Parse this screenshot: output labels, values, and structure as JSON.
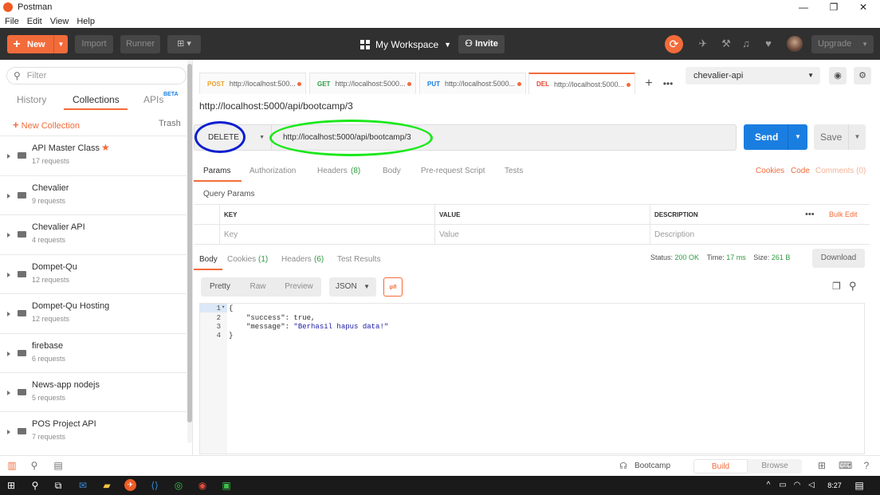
{
  "window": {
    "title": "Postman",
    "controls": [
      "—",
      "❐",
      "✕"
    ]
  },
  "menu": [
    "File",
    "Edit",
    "View",
    "Help"
  ],
  "header": {
    "new_label": "New",
    "import_label": "Import",
    "runner_label": "Runner",
    "workspace_label": "My Workspace",
    "invite_label": "Invite",
    "upgrade_label": "Upgrade"
  },
  "sidebar": {
    "filter_placeholder": "Filter",
    "tabs": [
      "History",
      "Collections",
      "APIs"
    ],
    "beta_badge": "BETA",
    "active_tab": "Collections",
    "new_collection_label": "New Collection",
    "trash_label": "Trash",
    "collections": [
      {
        "name": "API Master Class",
        "count": "17 requests",
        "starred": true
      },
      {
        "name": "Chevalier",
        "count": "9 requests"
      },
      {
        "name": "Chevalier API",
        "count": "4 requests"
      },
      {
        "name": "Dompet-Qu",
        "count": "12 requests"
      },
      {
        "name": "Dompet-Qu Hosting",
        "count": "12 requests"
      },
      {
        "name": "firebase",
        "count": "6 requests"
      },
      {
        "name": "News-app nodejs",
        "count": "5 requests"
      },
      {
        "name": "POS Project API",
        "count": "7 requests"
      }
    ]
  },
  "request_tabs": [
    {
      "method": "POST",
      "url": "http://localhost:500...",
      "color": "#f0a22b"
    },
    {
      "method": "GET",
      "url": "http://localhost:5000...",
      "color": "#2e9c3f"
    },
    {
      "method": "PUT",
      "url": "http://localhost:5000...",
      "color": "#1a7ee1"
    },
    {
      "method": "DEL",
      "url": "http://localhost:5000...",
      "color": "#e3432f"
    }
  ],
  "environment": {
    "selected": "chevalier-api"
  },
  "request": {
    "title": "http://localhost:5000/api/bootcamp/3",
    "method": "DELETE",
    "url": "http://localhost:5000/api/bootcamp/3",
    "send_label": "Send",
    "save_label": "Save"
  },
  "req_tabs": {
    "params": "Params",
    "authorization": "Authorization",
    "headers": "Headers",
    "headers_count": "(8)",
    "body": "Body",
    "prerequest": "Pre-request Script",
    "tests": "Tests",
    "cookies": "Cookies",
    "code": "Code",
    "comments": "Comments (0)"
  },
  "params": {
    "section_title": "Query Params",
    "headers": [
      "KEY",
      "VALUE",
      "DESCRIPTION"
    ],
    "bulk_edit": "Bulk Edit",
    "placeholders": [
      "Key",
      "Value",
      "Description"
    ]
  },
  "response": {
    "tabs": {
      "body": "Body",
      "cookies": "Cookies",
      "cookies_count": "(1)",
      "headers": "Headers",
      "headers_count": "(6)",
      "tests": "Test Results"
    },
    "status_label": "Status:",
    "status": "200 OK",
    "time_label": "Time:",
    "time": "17 ms",
    "size_label": "Size:",
    "size": "261 B",
    "download_label": "Download",
    "formats": [
      "Pretty",
      "Raw",
      "Preview"
    ],
    "type": "JSON",
    "lines": [
      "1",
      "2",
      "3",
      "4"
    ],
    "code": {
      "l1": "{",
      "k1": "\"success\"",
      "v1": "true,",
      "k2": "\"message\"",
      "v2": "\"Berhasil hapus data!\"",
      "l4": "}"
    }
  },
  "bottom": {
    "bootcamp_label": "Bootcamp",
    "build_label": "Build",
    "browse_label": "Browse"
  },
  "taskbar": {
    "time": "8:27"
  },
  "colors": {
    "accent": "#f26b3a",
    "send": "#1a7ee1",
    "status_ok": "#2e9c3f",
    "annotation_blue": "#0b1ed1",
    "annotation_green": "#1ce81c"
  }
}
